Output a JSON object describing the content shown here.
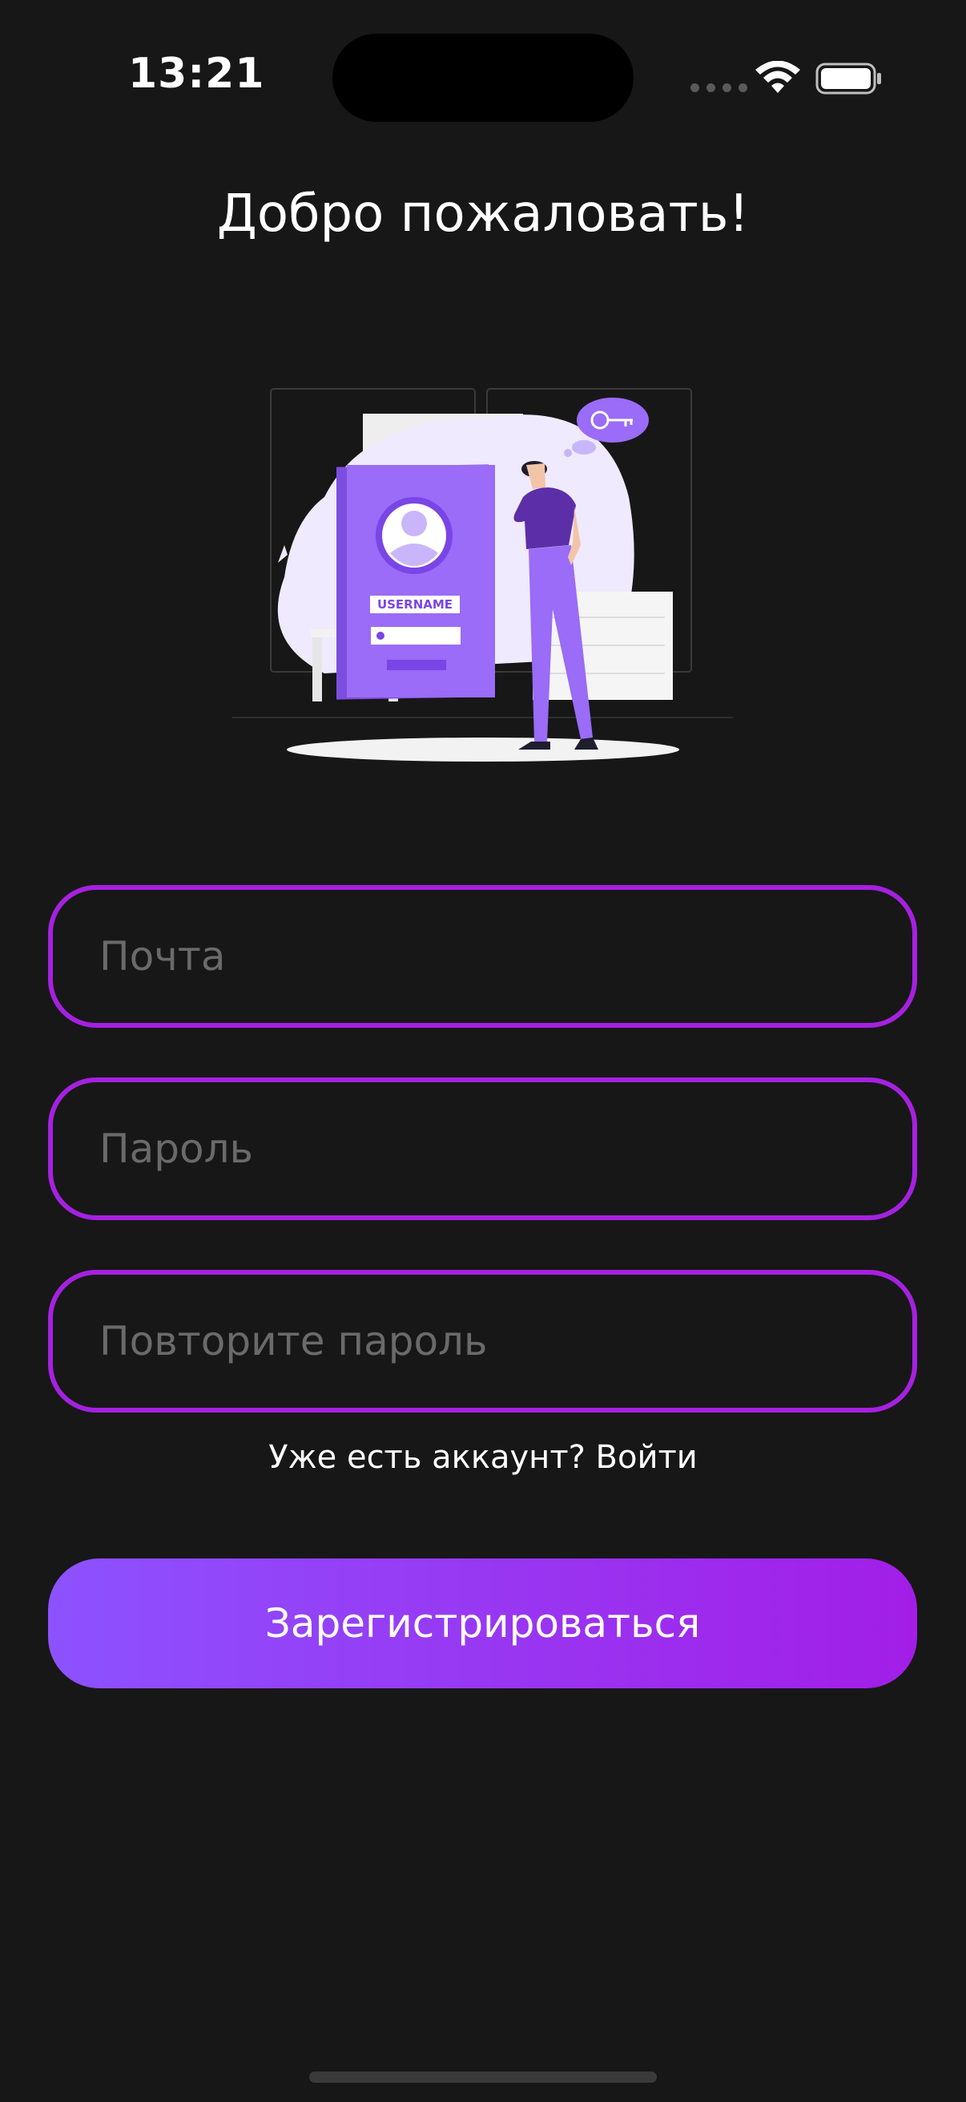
{
  "status_bar": {
    "time": "13:21"
  },
  "header": {
    "title": "Добро пожаловать!"
  },
  "illustration": {
    "badge_label": "USERNAME"
  },
  "form": {
    "email_placeholder": "Почта",
    "password_placeholder": "Пароль",
    "repeat_password_placeholder": "Повторите пароль",
    "login_prompt": "Уже есть аккаунт? Войти",
    "register_label": "Зарегистрироваться"
  },
  "colors": {
    "background": "#171717",
    "field_border": "#a521e0",
    "button_gradient_start": "#8d52ff",
    "button_gradient_end": "#a21ee7",
    "placeholder": "#6a6a6a"
  }
}
